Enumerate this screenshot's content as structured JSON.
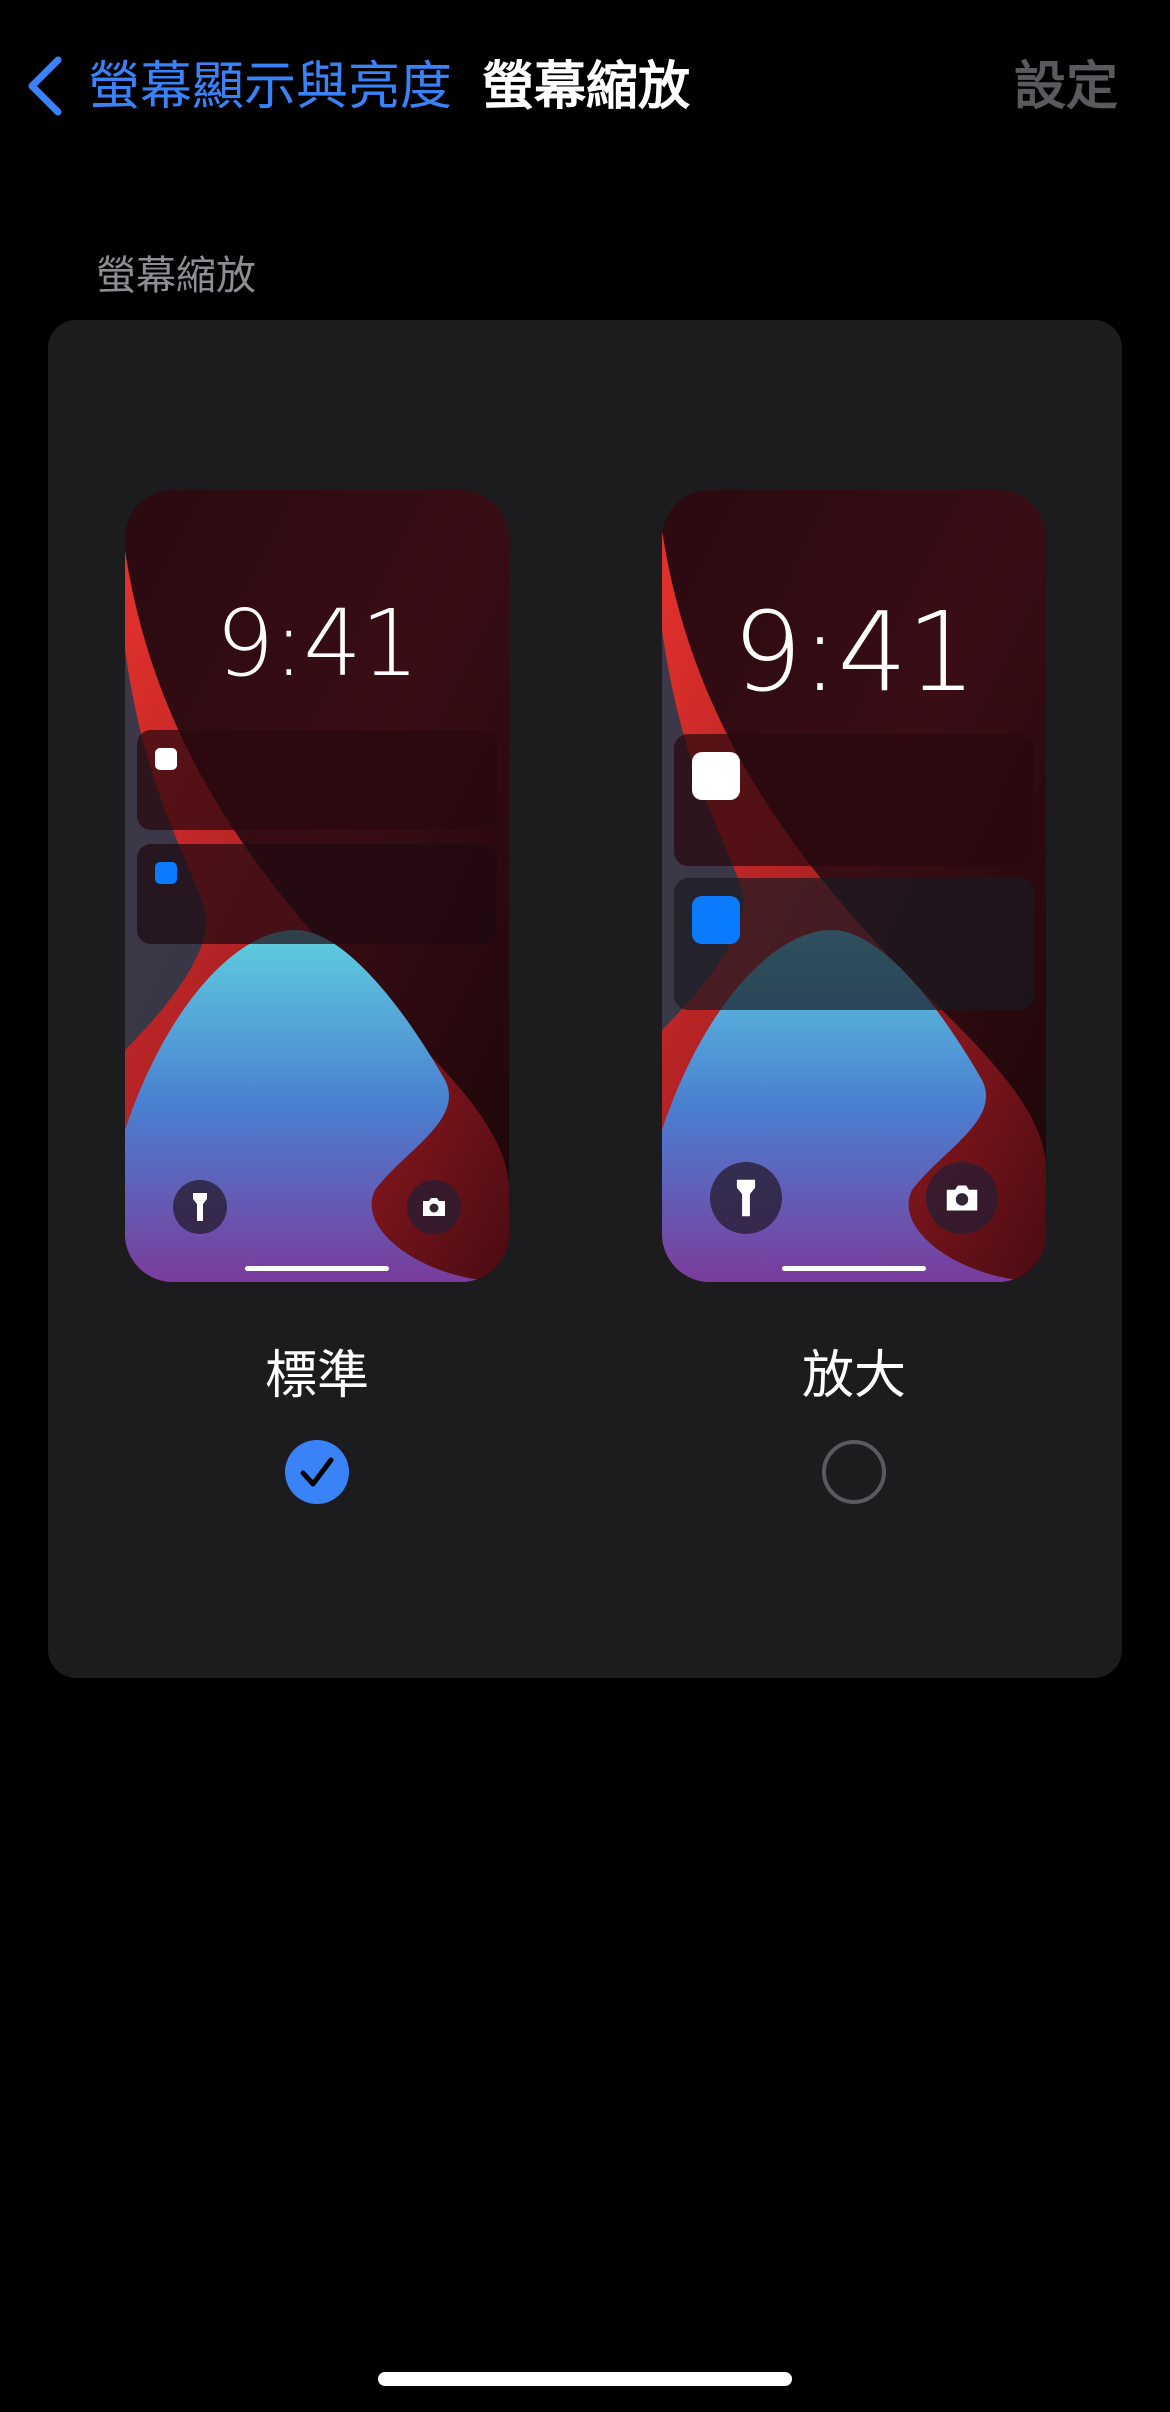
{
  "nav": {
    "back_label": "螢幕顯示與亮度",
    "title": "螢幕縮放",
    "action": "設定"
  },
  "section": {
    "header": "螢幕縮放"
  },
  "options": [
    {
      "label": "標準",
      "time": "9:41",
      "selected": true
    },
    {
      "label": "放大",
      "time": "9:41",
      "selected": false
    }
  ],
  "colors": {
    "accent": "#3a82f7",
    "background": "#000000",
    "card": "#1c1c1e",
    "notification_icon_blue": "#0a7aff"
  }
}
